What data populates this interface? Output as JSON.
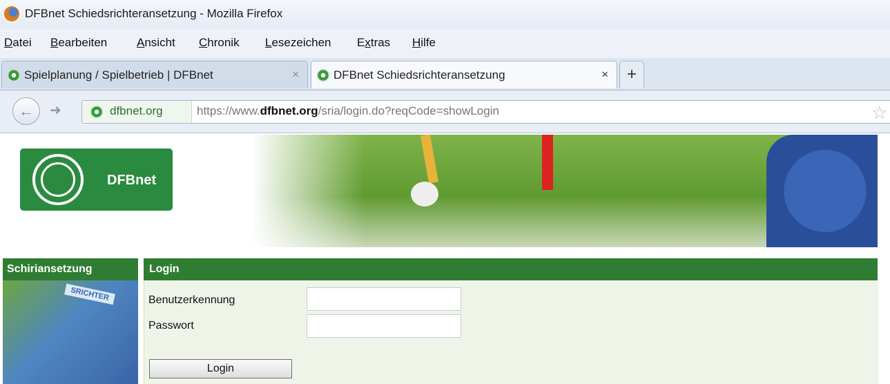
{
  "window": {
    "title": "DFBnet Schiedsrichteransetzung - Mozilla Firefox"
  },
  "menu": [
    {
      "key": "D",
      "rest": "atei"
    },
    {
      "key": "B",
      "rest": "earbeiten"
    },
    {
      "key": "A",
      "rest": "nsicht"
    },
    {
      "key": "C",
      "rest": "hronik"
    },
    {
      "key": "L",
      "rest": "esezeichen"
    },
    {
      "pre": "E",
      "key": "x",
      "rest": "tras"
    },
    {
      "key": "H",
      "rest": "ilfe"
    }
  ],
  "tabs": [
    {
      "label": "Spielplanung / Spielbetrieb | DFBnet",
      "close": "×"
    },
    {
      "label": "DFBnet Schiedsrichteransetzung",
      "close": "×"
    }
  ],
  "new_tab": "+",
  "nav": {
    "back_icon": "arrow-left",
    "forward_icon": "arrow-right",
    "identity": "dfbnet.org",
    "url_prefix": "https://www.",
    "url_domain": "dfbnet.org",
    "url_path": "/sria/login.do?reqCode=showLogin",
    "bookmark_icon": "star"
  },
  "page": {
    "logo_text": "DFBnet",
    "side_title": "Schiriansetzung",
    "side_image_label": "SRICHTER",
    "login_title": "Login",
    "fields": {
      "username_label": "Benutzerkennung",
      "username_value": "",
      "password_label": "Passwort",
      "password_value": ""
    },
    "login_button": "Login"
  },
  "colors": {
    "green": "#2f7d32",
    "panel_bg": "#eef5e8",
    "logo_green": "#2a8a3f"
  }
}
